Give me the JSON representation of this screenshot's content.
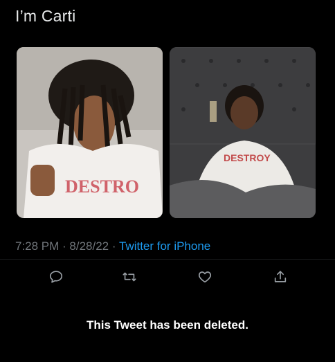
{
  "tweet": {
    "text": "I’m Carti",
    "time": "7:28 PM",
    "separator1": " · ",
    "date": "8/28/22",
    "separator2": " · ",
    "source": "Twitter for iPhone"
  },
  "media": [
    {
      "label": "photo-1"
    },
    {
      "label": "photo-2"
    }
  ],
  "actions": {
    "reply_icon": "reply-icon",
    "retweet_icon": "retweet-icon",
    "like_icon": "like-icon",
    "share_icon": "share-icon"
  },
  "status": {
    "message": "This Tweet has been deleted."
  },
  "colors": {
    "background": "#000000",
    "text": "#e7e9ea",
    "muted": "#71767b",
    "accent": "#1d9bf0"
  }
}
